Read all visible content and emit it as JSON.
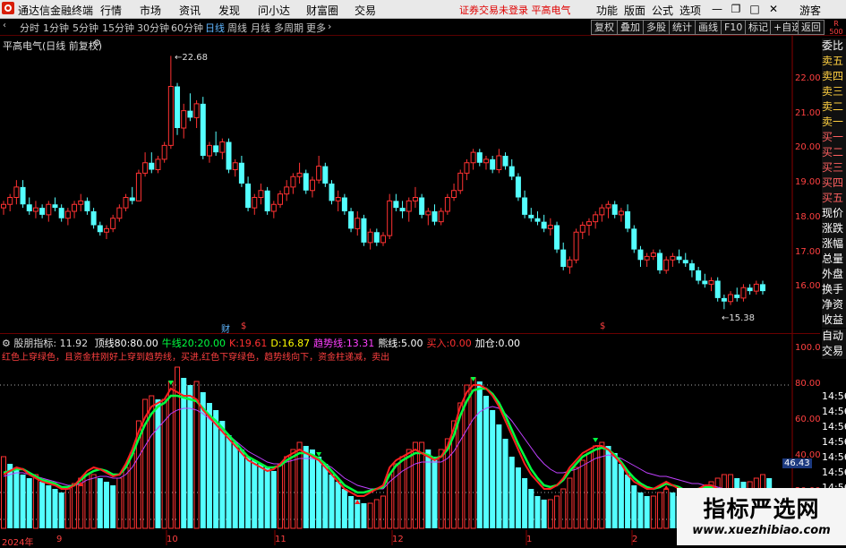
{
  "app": {
    "title": "通达信金融终端"
  },
  "menu": [
    "行情",
    "市场",
    "资讯",
    "发现",
    "问小达",
    "财富圈",
    "交易"
  ],
  "warning": "证券交易未登录  平高电气",
  "right_menu": [
    "功能",
    "版面",
    "公式",
    "选项"
  ],
  "guest": "游客",
  "window_buttons": [
    "minimize-icon",
    "restore-icon",
    "maximize-icon",
    "close-icon"
  ],
  "period_tabs": [
    "分时",
    "1分钟",
    "5分钟",
    "15分钟",
    "30分钟",
    "60分钟",
    "日线",
    "周线",
    "月线",
    "多周期",
    "更多"
  ],
  "active_tab": "日线",
  "right_buttons": [
    "复权",
    "叠加",
    "多股",
    "统计",
    "画线",
    "F10",
    "标记",
    "+自选",
    "返回"
  ],
  "r_badge": [
    "R",
    "500"
  ],
  "chart": {
    "name": "平高电气(日线 前复权)",
    "high_label": "22.68",
    "low_label": "15.38",
    "y_ticks": [
      "22.00",
      "21.00",
      "20.00",
      "19.00",
      "18.00",
      "17.00",
      "16.00"
    ],
    "markers": [
      "财",
      "$",
      "$"
    ]
  },
  "sidebar": [
    "委比",
    "卖五",
    "卖四",
    "卖三",
    "卖二",
    "卖一",
    "买一",
    "买二",
    "买三",
    "买四",
    "买五",
    "现价",
    "涨跌",
    "涨幅",
    "总量",
    "外盘",
    "换手",
    "净资",
    "收益",
    "自动",
    "交易"
  ],
  "right_times": [
    "14:56",
    "14:56",
    "14:56",
    "14:56",
    "14:56",
    "14:56",
    "14:56",
    "14:56",
    "14:56"
  ],
  "indicator": {
    "name": "股朋指标",
    "value": ": 11.92",
    "items": [
      {
        "label": "顶线80:",
        "value": "80.00",
        "color": "#ffffff"
      },
      {
        "label": "牛线20:",
        "value": "20.00",
        "color": "#00ff40"
      },
      {
        "label": "K:",
        "value": "19.61",
        "color": "#ff3030"
      },
      {
        "label": "D:",
        "value": "16.87",
        "color": "#ffff00"
      },
      {
        "label": "趋势线:",
        "value": "13.31",
        "color": "#ff40ff"
      },
      {
        "label": "熊线:",
        "value": "5.00",
        "color": "#ffffff"
      },
      {
        "label": "买入:",
        "value": "0.00",
        "color": "#ff3030"
      },
      {
        "label": "加仓:",
        "value": "0.00",
        "color": "#ffffff"
      }
    ],
    "description": "红色上穿绿色，且资金柱刚好上穿到趋势线，买进,红色下穿绿色，趋势线向下，资金柱递减，卖出",
    "y_ticks": [
      "100.0",
      "80.00",
      "60.00",
      "40.00",
      "20.00"
    ],
    "current_value": "46.43"
  },
  "x_labels": [
    "2024年",
    "9",
    "10",
    "11",
    "12",
    "1",
    "2"
  ],
  "watermark": {
    "title": "指标严选网",
    "url": "www.xuezhibiao.com"
  },
  "chart_data": {
    "type": "candlestick",
    "title": "平高电气(日线 前复权)",
    "ylim": [
      15.0,
      23.0
    ],
    "candles": [
      [
        18.3,
        18.5,
        18.1,
        18.4
      ],
      [
        18.4,
        18.7,
        18.2,
        18.6
      ],
      [
        18.6,
        19.1,
        18.4,
        18.9
      ],
      [
        18.9,
        19.1,
        18.3,
        18.4
      ],
      [
        18.4,
        18.6,
        18.1,
        18.2
      ],
      [
        18.2,
        18.5,
        18.0,
        18.3
      ],
      [
        18.3,
        18.4,
        18.0,
        18.1
      ],
      [
        18.1,
        18.5,
        17.9,
        18.4
      ],
      [
        18.4,
        18.6,
        18.2,
        18.3
      ],
      [
        18.3,
        18.4,
        17.9,
        18.0
      ],
      [
        18.0,
        18.3,
        17.8,
        18.2
      ],
      [
        18.2,
        18.5,
        18.0,
        18.4
      ],
      [
        18.4,
        18.7,
        18.2,
        18.5
      ],
      [
        18.5,
        18.6,
        18.1,
        18.2
      ],
      [
        18.2,
        18.3,
        17.7,
        17.8
      ],
      [
        17.8,
        17.9,
        17.5,
        17.6
      ],
      [
        17.6,
        17.8,
        17.4,
        17.7
      ],
      [
        17.7,
        18.1,
        17.6,
        18.0
      ],
      [
        18.0,
        18.4,
        17.9,
        18.3
      ],
      [
        18.3,
        18.7,
        18.2,
        18.6
      ],
      [
        18.6,
        18.9,
        18.4,
        18.5
      ],
      [
        18.5,
        19.4,
        18.5,
        19.3
      ],
      [
        19.3,
        19.9,
        19.2,
        19.6
      ],
      [
        19.6,
        19.9,
        19.3,
        19.4
      ],
      [
        19.4,
        19.8,
        19.3,
        19.7
      ],
      [
        19.7,
        20.2,
        19.6,
        20.1
      ],
      [
        20.1,
        22.68,
        20.0,
        21.8
      ],
      [
        21.8,
        21.9,
        20.4,
        20.6
      ],
      [
        20.6,
        21.3,
        20.3,
        21.1
      ],
      [
        21.1,
        21.6,
        20.8,
        20.9
      ],
      [
        20.9,
        21.4,
        20.6,
        21.3
      ],
      [
        21.3,
        21.5,
        19.7,
        19.8
      ],
      [
        19.8,
        20.2,
        19.6,
        20.1
      ],
      [
        20.1,
        20.5,
        19.8,
        19.9
      ],
      [
        19.9,
        20.3,
        19.7,
        20.2
      ],
      [
        20.2,
        20.3,
        19.3,
        19.4
      ],
      [
        19.4,
        19.7,
        19.2,
        19.6
      ],
      [
        19.6,
        19.8,
        18.9,
        19.0
      ],
      [
        19.0,
        19.2,
        18.2,
        18.3
      ],
      [
        18.3,
        18.7,
        18.1,
        18.6
      ],
      [
        18.6,
        19.0,
        18.4,
        18.8
      ],
      [
        18.8,
        18.9,
        18.1,
        18.2
      ],
      [
        18.2,
        18.5,
        18.0,
        18.4
      ],
      [
        18.4,
        18.8,
        18.3,
        18.7
      ],
      [
        18.7,
        19.1,
        18.5,
        18.9
      ],
      [
        18.9,
        19.3,
        18.7,
        19.2
      ],
      [
        19.2,
        19.6,
        19.0,
        19.3
      ],
      [
        19.3,
        19.4,
        18.7,
        18.8
      ],
      [
        18.8,
        19.2,
        18.6,
        19.1
      ],
      [
        19.1,
        19.8,
        19.0,
        19.5
      ],
      [
        19.5,
        19.6,
        18.9,
        19.0
      ],
      [
        19.0,
        19.1,
        18.4,
        18.5
      ],
      [
        18.5,
        18.8,
        18.2,
        18.6
      ],
      [
        18.6,
        18.7,
        18.1,
        18.2
      ],
      [
        18.2,
        18.3,
        17.6,
        17.7
      ],
      [
        17.7,
        18.2,
        17.5,
        18.0
      ],
      [
        18.0,
        18.1,
        17.2,
        17.3
      ],
      [
        17.3,
        17.7,
        17.1,
        17.6
      ],
      [
        17.6,
        17.7,
        17.2,
        17.3
      ],
      [
        17.3,
        17.6,
        17.2,
        17.5
      ],
      [
        17.5,
        18.7,
        17.4,
        18.5
      ],
      [
        18.5,
        18.7,
        18.2,
        18.3
      ],
      [
        18.3,
        18.5,
        18.0,
        18.2
      ],
      [
        18.2,
        18.6,
        17.9,
        18.5
      ],
      [
        18.5,
        18.9,
        18.3,
        18.6
      ],
      [
        18.6,
        18.7,
        18.0,
        18.1
      ],
      [
        18.1,
        18.3,
        17.8,
        18.2
      ],
      [
        18.2,
        18.4,
        17.8,
        17.9
      ],
      [
        17.9,
        18.3,
        17.8,
        18.2
      ],
      [
        18.2,
        18.7,
        18.1,
        18.6
      ],
      [
        18.6,
        19.0,
        18.5,
        18.8
      ],
      [
        18.8,
        19.4,
        18.7,
        19.3
      ],
      [
        19.3,
        19.7,
        19.1,
        19.6
      ],
      [
        19.6,
        20.0,
        19.4,
        19.9
      ],
      [
        19.9,
        20.0,
        19.5,
        19.6
      ],
      [
        19.6,
        19.8,
        19.4,
        19.7
      ],
      [
        19.7,
        19.8,
        19.3,
        19.4
      ],
      [
        19.4,
        20.0,
        19.3,
        19.8
      ],
      [
        19.8,
        19.9,
        19.4,
        19.5
      ],
      [
        19.5,
        19.7,
        19.1,
        19.2
      ],
      [
        19.2,
        19.3,
        18.5,
        18.6
      ],
      [
        18.6,
        18.8,
        18.0,
        18.1
      ],
      [
        18.1,
        18.3,
        17.9,
        18.0
      ],
      [
        18.0,
        18.2,
        17.8,
        17.9
      ],
      [
        17.9,
        18.1,
        17.6,
        17.7
      ],
      [
        17.7,
        18.0,
        17.5,
        17.8
      ],
      [
        17.8,
        17.9,
        17.0,
        17.1
      ],
      [
        17.1,
        17.3,
        16.5,
        16.6
      ],
      [
        16.6,
        16.9,
        16.4,
        16.8
      ],
      [
        16.8,
        17.7,
        16.7,
        17.6
      ],
      [
        17.6,
        17.9,
        17.4,
        17.8
      ],
      [
        17.8,
        18.0,
        17.5,
        17.9
      ],
      [
        17.9,
        18.2,
        17.7,
        18.1
      ],
      [
        18.1,
        18.4,
        17.9,
        18.3
      ],
      [
        18.3,
        18.5,
        18.0,
        18.4
      ],
      [
        18.4,
        18.5,
        18.0,
        18.1
      ],
      [
        18.1,
        18.3,
        17.9,
        18.2
      ],
      [
        18.2,
        18.4,
        17.6,
        17.7
      ],
      [
        17.7,
        17.8,
        17.0,
        17.1
      ],
      [
        17.1,
        17.2,
        16.6,
        16.8
      ],
      [
        16.8,
        17.0,
        16.6,
        16.9
      ],
      [
        16.9,
        17.1,
        16.8,
        17.0
      ],
      [
        17.0,
        17.1,
        16.4,
        16.5
      ],
      [
        16.5,
        16.9,
        16.4,
        16.8
      ],
      [
        16.8,
        17.0,
        16.6,
        16.9
      ],
      [
        16.9,
        17.1,
        16.7,
        16.8
      ],
      [
        16.8,
        17.0,
        16.6,
        16.7
      ],
      [
        16.7,
        16.8,
        16.3,
        16.5
      ],
      [
        16.5,
        16.6,
        16.1,
        16.2
      ],
      [
        16.2,
        16.4,
        16.0,
        16.1
      ],
      [
        16.1,
        16.3,
        15.9,
        16.2
      ],
      [
        16.2,
        16.3,
        15.6,
        15.7
      ],
      [
        15.7,
        15.8,
        15.38,
        15.6
      ],
      [
        15.6,
        15.9,
        15.5,
        15.8
      ],
      [
        15.8,
        16.0,
        15.6,
        15.7
      ],
      [
        15.7,
        16.1,
        15.6,
        16.0
      ],
      [
        16.0,
        16.1,
        15.8,
        15.9
      ],
      [
        15.9,
        16.2,
        15.8,
        16.1
      ],
      [
        16.1,
        16.2,
        15.8,
        15.9
      ]
    ],
    "volume": [
      40,
      36,
      34,
      30,
      28,
      30,
      26,
      24,
      22,
      20,
      22,
      25,
      28,
      30,
      30,
      28,
      26,
      24,
      28,
      34,
      42,
      60,
      72,
      74,
      72,
      72,
      82,
      90,
      84,
      80,
      82,
      76,
      70,
      66,
      60,
      52,
      48,
      44,
      40,
      38,
      36,
      34,
      32,
      36,
      40,
      44,
      48,
      46,
      44,
      40,
      36,
      30,
      26,
      22,
      18,
      16,
      14,
      14,
      16,
      18,
      30,
      36,
      40,
      44,
      48,
      48,
      44,
      40,
      44,
      50,
      60,
      70,
      80,
      84,
      82,
      74,
      66,
      58,
      50,
      40,
      34,
      28,
      22,
      18,
      16,
      16,
      18,
      22,
      28,
      34,
      38,
      42,
      46,
      48,
      46,
      42,
      36,
      30,
      24,
      20,
      18,
      18,
      20,
      22,
      20,
      18,
      16,
      16,
      18,
      22,
      26,
      28,
      30,
      30,
      28,
      26,
      26,
      28,
      30,
      28
    ],
    "K": [
      30,
      32,
      34,
      33,
      30,
      28,
      26,
      25,
      24,
      22,
      22,
      24,
      28,
      32,
      34,
      33,
      31,
      29,
      30,
      36,
      44,
      54,
      62,
      68,
      70,
      72,
      78,
      76,
      74,
      74,
      72,
      66,
      62,
      58,
      54,
      50,
      46,
      42,
      38,
      36,
      34,
      32,
      33,
      36,
      40,
      42,
      44,
      42,
      40,
      38,
      34,
      30,
      26,
      22,
      20,
      18,
      18,
      20,
      22,
      24,
      34,
      38,
      40,
      42,
      44,
      42,
      40,
      38,
      40,
      46,
      56,
      68,
      76,
      80,
      80,
      78,
      74,
      68,
      60,
      52,
      44,
      36,
      30,
      26,
      22,
      22,
      24,
      28,
      34,
      38,
      42,
      44,
      46,
      46,
      44,
      40,
      36,
      30,
      26,
      24,
      22,
      22,
      24,
      26,
      24,
      22,
      20,
      20,
      22,
      24,
      24,
      22,
      20,
      20,
      20,
      20,
      20,
      20,
      20,
      20
    ],
    "D": [
      31,
      32,
      33,
      33,
      31,
      29,
      27,
      26,
      25,
      23,
      23,
      24,
      27,
      30,
      32,
      33,
      32,
      30,
      30,
      34,
      41,
      50,
      58,
      64,
      68,
      70,
      74,
      74,
      73,
      72,
      71,
      67,
      63,
      60,
      56,
      52,
      48,
      44,
      40,
      38,
      36,
      34,
      34,
      35,
      38,
      40,
      42,
      42,
      41,
      39,
      36,
      32,
      28,
      24,
      22,
      20,
      20,
      21,
      22,
      23,
      30,
      35,
      38,
      40,
      42,
      42,
      41,
      39,
      40,
      44,
      52,
      63,
      71,
      77,
      78,
      78,
      75,
      70,
      63,
      55,
      47,
      40,
      33,
      28,
      24,
      23,
      24,
      27,
      32,
      36,
      40,
      42,
      44,
      45,
      44,
      41,
      37,
      32,
      28,
      25,
      23,
      22,
      23,
      25,
      24,
      23,
      21,
      21,
      22,
      23,
      23,
      22,
      21,
      20,
      20,
      20,
      19,
      19,
      18,
      17
    ],
    "trend": [
      29,
      30,
      31,
      31,
      30,
      29,
      28,
      27,
      26,
      25,
      24,
      24,
      25,
      27,
      28,
      29,
      29,
      28,
      28,
      30,
      34,
      40,
      46,
      52,
      56,
      60,
      64,
      66,
      67,
      67,
      66,
      64,
      61,
      58,
      55,
      52,
      49,
      46,
      43,
      41,
      39,
      37,
      36,
      36,
      37,
      38,
      39,
      39,
      39,
      38,
      36,
      34,
      31,
      28,
      26,
      24,
      23,
      22,
      22,
      22,
      26,
      29,
      32,
      34,
      36,
      37,
      37,
      37,
      37,
      39,
      43,
      49,
      55,
      61,
      65,
      67,
      68,
      67,
      64,
      60,
      55,
      50,
      45,
      40,
      36,
      33,
      31,
      31,
      32,
      33,
      35,
      37,
      39,
      40,
      41,
      40,
      39,
      37,
      35,
      33,
      31,
      30,
      29,
      29,
      28,
      27,
      26,
      25,
      25,
      24,
      24,
      23,
      22,
      22,
      21,
      21,
      20,
      19,
      18,
      17
    ]
  }
}
